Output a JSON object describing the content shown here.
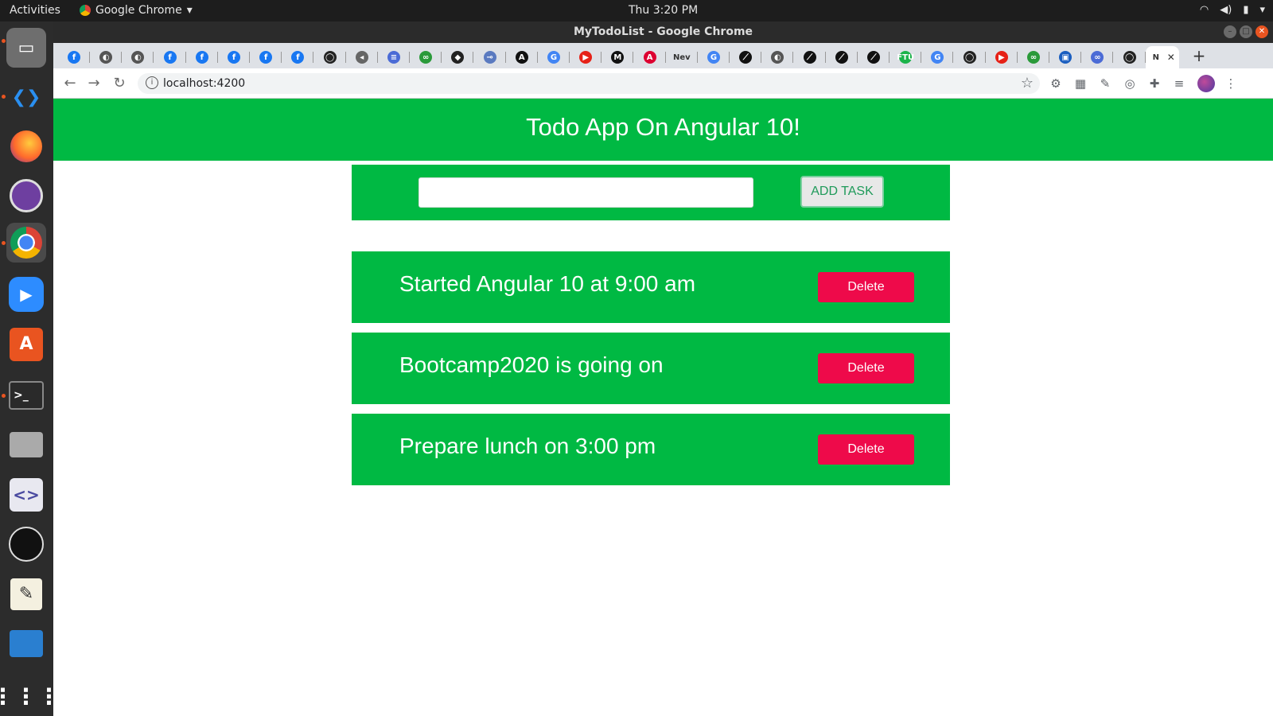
{
  "topbar": {
    "activities": "Activities",
    "app_name": "Google Chrome",
    "clock": "Thu  3:20 PM"
  },
  "dock": {
    "items": [
      "files-icon",
      "vscode-icon",
      "firefox-icon",
      "github-desktop-icon",
      "chrome-icon",
      "zoom-icon",
      "software-center-icon",
      "terminal-icon",
      "camera-icon",
      "code-editor-icon",
      "obs-icon",
      "text-editor-icon",
      "monitor-icon",
      "app-grid-icon"
    ]
  },
  "window": {
    "title": "MyTodoList - Google Chrome"
  },
  "tabs": [
    {
      "icon": "facebook-icon",
      "color": "#1877f2",
      "glyph": "f"
    },
    {
      "icon": "generic-icon",
      "color": "#555",
      "glyph": "◐"
    },
    {
      "icon": "generic-icon",
      "color": "#555",
      "glyph": "◐"
    },
    {
      "icon": "facebook-icon",
      "color": "#1877f2",
      "glyph": "f"
    },
    {
      "icon": "facebook-icon",
      "color": "#1877f2",
      "glyph": "f"
    },
    {
      "icon": "facebook-icon",
      "color": "#1877f2",
      "glyph": "f"
    },
    {
      "icon": "facebook-icon",
      "color": "#1877f2",
      "glyph": "f"
    },
    {
      "icon": "facebook-icon",
      "color": "#1877f2",
      "glyph": "f"
    },
    {
      "icon": "github-icon",
      "color": "#222",
      "glyph": "◯"
    },
    {
      "icon": "audio-icon",
      "color": "#666",
      "glyph": "◂"
    },
    {
      "icon": "docs-icon",
      "color": "#4b6bd6",
      "glyph": "≡"
    },
    {
      "icon": "link-icon",
      "color": "#2a9a3a",
      "glyph": "∞"
    },
    {
      "icon": "generic-icon",
      "color": "#222",
      "glyph": "◆"
    },
    {
      "icon": "key-icon",
      "color": "#5a7ac0",
      "glyph": "⊸"
    },
    {
      "icon": "generic-icon",
      "color": "#111",
      "glyph": "A"
    },
    {
      "icon": "google-icon",
      "color": "#4285f4",
      "glyph": "G"
    },
    {
      "icon": "youtube-icon",
      "color": "#e62117",
      "glyph": "▶"
    },
    {
      "icon": "medium-icon",
      "color": "#111",
      "glyph": "M"
    },
    {
      "icon": "angular-icon",
      "color": "#dd0031",
      "glyph": "A"
    },
    {
      "icon": "text-tab",
      "color": "transparent",
      "glyph": "Nev"
    },
    {
      "icon": "google-icon",
      "color": "#4285f4",
      "glyph": "G"
    },
    {
      "icon": "generic-icon",
      "color": "#111",
      "glyph": "⟋"
    },
    {
      "icon": "generic-icon",
      "color": "#555",
      "glyph": "◐"
    },
    {
      "icon": "generic-icon",
      "color": "#111",
      "glyph": "⟋"
    },
    {
      "icon": "generic-icon",
      "color": "#111",
      "glyph": "⟋"
    },
    {
      "icon": "generic-icon",
      "color": "#111",
      "glyph": "⟋"
    },
    {
      "icon": "ftu-icon",
      "color": "#1bb34a",
      "glyph": "FTU"
    },
    {
      "icon": "google-icon",
      "color": "#4285f4",
      "glyph": "G"
    },
    {
      "icon": "github-icon",
      "color": "#222",
      "glyph": "◯"
    },
    {
      "icon": "youtube-icon",
      "color": "#e62117",
      "glyph": "▶"
    },
    {
      "icon": "link-icon",
      "color": "#2a9a3a",
      "glyph": "∞"
    },
    {
      "icon": "generic-icon",
      "color": "#1a5ec0",
      "glyph": "▣"
    },
    {
      "icon": "link-icon",
      "color": "#4b6bd6",
      "glyph": "∞"
    },
    {
      "icon": "github-icon",
      "color": "#222",
      "glyph": "◯"
    },
    {
      "icon": "active-tab",
      "color": "transparent",
      "glyph": "N"
    }
  ],
  "address_bar": {
    "url": "localhost:4200"
  },
  "app": {
    "header": "Todo App On Angular 10!",
    "input_value": "",
    "add_button": "ADD TASK",
    "todos": [
      {
        "text": "Started Angular 10 at 9:00 am",
        "delete_label": "Delete"
      },
      {
        "text": "Bootcamp2020 is going on",
        "delete_label": "Delete"
      },
      {
        "text": "Prepare lunch on 3:00 pm",
        "delete_label": "Delete"
      }
    ]
  },
  "colors": {
    "accent_green": "#00b943",
    "delete_red": "#ee0a4a"
  }
}
